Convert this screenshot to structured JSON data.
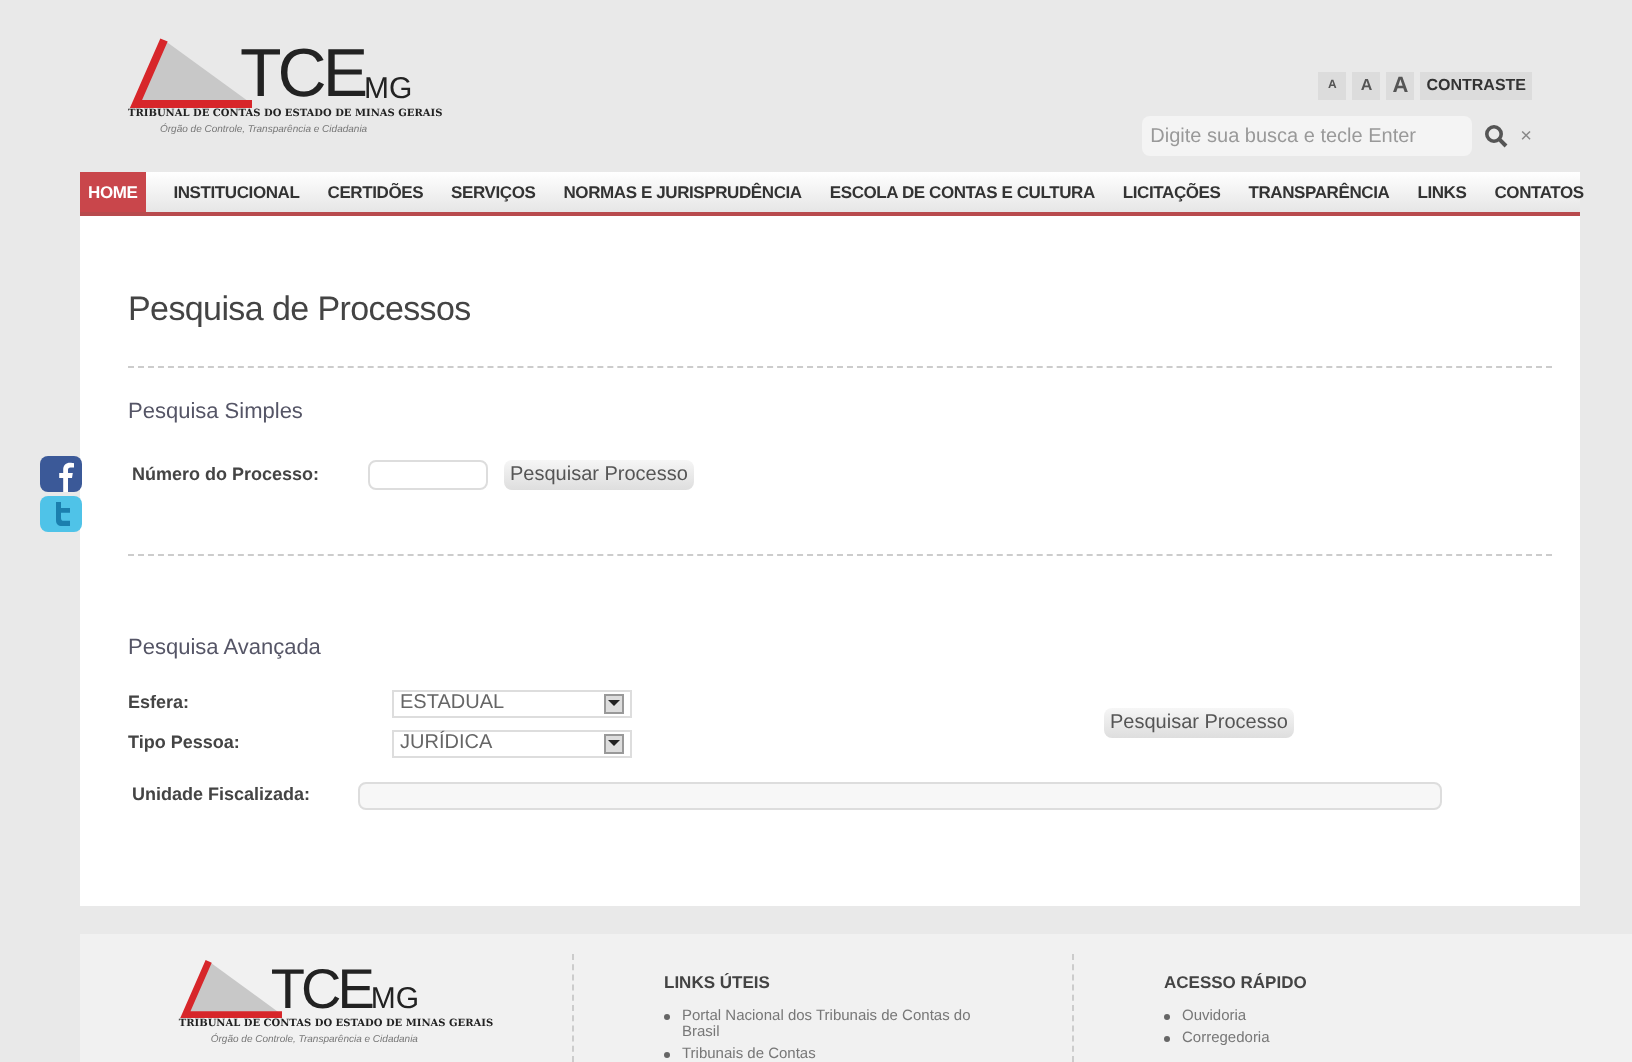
{
  "header": {
    "logo": {
      "mark": "TCE",
      "suffix": "MG",
      "name": "TRIBUNAL DE CONTAS DO ESTADO DE MINAS GERAIS",
      "tagline": "Órgão de Controle, Transparência e Cidadania"
    },
    "font_sizes": [
      {
        "label": "A",
        "selected": false
      },
      {
        "label": "A",
        "selected": false
      },
      {
        "label": "A",
        "selected": false
      }
    ],
    "contrast": "CONTRASTE",
    "search": {
      "placeholder": "Digite sua busca e tecle Enter",
      "clear": "×"
    }
  },
  "nav": [
    {
      "label": "HOME",
      "selected": true
    },
    {
      "label": "INSTITUCIONAL",
      "selected": false
    },
    {
      "label": "CERTIDÕES",
      "selected": false
    },
    {
      "label": "SERVIÇOS",
      "selected": false
    },
    {
      "label": "NORMAS E JURISPRUDÊNCIA",
      "selected": false
    },
    {
      "label": "ESCOLA DE CONTAS E CULTURA",
      "selected": false
    },
    {
      "label": "LICITAÇÕES",
      "selected": false
    },
    {
      "label": "TRANSPARÊNCIA",
      "selected": false
    },
    {
      "label": "LINKS",
      "selected": false
    },
    {
      "label": "CONTATOS",
      "selected": false
    }
  ],
  "page_title": "Pesquisa de Processos",
  "simple": {
    "title": "Pesquisa Simples",
    "label": "Número do Processo:",
    "button": "Pesquisar Processo"
  },
  "advanced": {
    "title": "Pesquisa Avançada",
    "selects": [
      {
        "label": "Esfera:",
        "value": "ESTADUAL"
      },
      {
        "label": "Tipo Pessoa:",
        "value": "JURÍDICA"
      }
    ],
    "unit_label": "Unidade Fiscalizada:",
    "button": "Pesquisar Processo"
  },
  "footer": {
    "logo": {
      "mark": "TCE",
      "suffix": "MG",
      "name": "TRIBUNAL DE CONTAS DO ESTADO DE MINAS GERAIS",
      "tagline": "Órgão de Controle, Transparência e Cidadania"
    },
    "columns": [
      {
        "title": "LINKS ÚTEIS",
        "links": [
          "Portal Nacional dos Tribunais de Contas do Brasil",
          "Tribunais de Contas"
        ]
      },
      {
        "title": "ACESSO RÁPIDO",
        "links": [
          "Ouvidoria",
          "Corregedoria"
        ]
      }
    ]
  }
}
